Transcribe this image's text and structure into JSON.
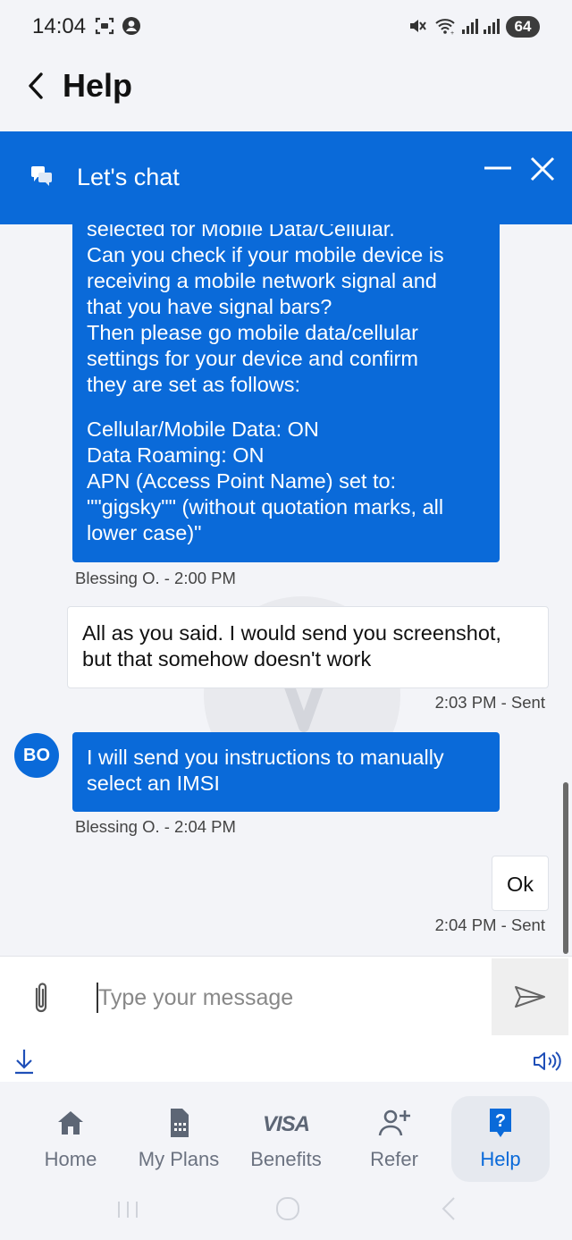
{
  "status_bar": {
    "time": "14:04",
    "battery": "64"
  },
  "header": {
    "title": "Help"
  },
  "chat": {
    "title": "Let's chat",
    "messages": [
      {
        "sender": "agent",
        "lines": [
          "selected for Mobile Data/Cellular.",
          "Can you check if your mobile device is",
          "receiving a mobile network signal and",
          "that you have signal bars?",
          "Then please go mobile data/cellular",
          "settings for your device and confirm",
          "they are set as follows:",
          "",
          "Cellular/Mobile Data: ON",
          "Data Roaming: ON",
          "APN (Access Point Name) set to:",
          "\"\"gigsky\"\" (without quotation marks, all",
          "lower case)\""
        ],
        "meta": "Blessing O. - 2:00 PM"
      },
      {
        "sender": "user",
        "lines": [
          "All as you said. I would send you screenshot,",
          "but that somehow doesn't work"
        ],
        "meta": "2:03 PM - Sent"
      },
      {
        "sender": "agent",
        "avatar": "BO",
        "lines": [
          "I will send you instructions to manually",
          "select an IMSI"
        ],
        "meta": "Blessing O. - 2:04 PM"
      },
      {
        "sender": "user",
        "lines": [
          "Ok"
        ],
        "meta": "2:04 PM - Sent"
      }
    ],
    "input_placeholder": "Type your message"
  },
  "nav": {
    "items": [
      {
        "label": "Home",
        "icon": "home-icon"
      },
      {
        "label": "My Plans",
        "icon": "sim-card-icon"
      },
      {
        "label": "Benefits",
        "icon": "visa-icon",
        "icon_text": "VISA"
      },
      {
        "label": "Refer",
        "icon": "add-person-icon"
      },
      {
        "label": "Help",
        "icon": "help-icon",
        "active": true
      }
    ]
  },
  "colors": {
    "primary": "#0a6ad9",
    "background": "#f3f4f8",
    "nav_inactive": "#6b7280"
  }
}
